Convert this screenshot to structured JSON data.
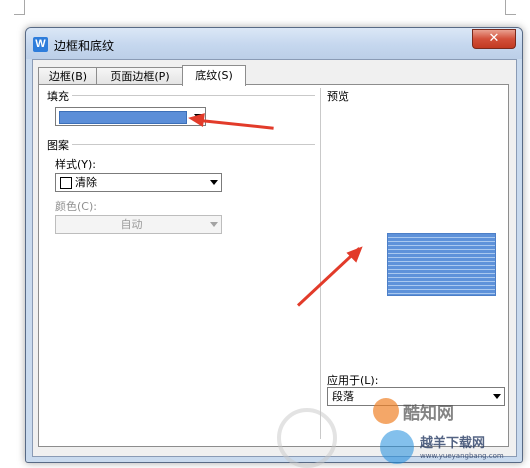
{
  "window": {
    "title": "边框和底纹",
    "app_icon_glyph": "W",
    "close_glyph": "✕"
  },
  "tabs": [
    {
      "label": "边框(B)"
    },
    {
      "label": "页面边框(P)"
    },
    {
      "label": "底纹(S)"
    }
  ],
  "fill": {
    "label": "填充",
    "color": "#5b8ed8"
  },
  "pattern": {
    "label": "图案",
    "style_label": "样式(Y):",
    "style_value": "清除",
    "color_label": "颜色(C):",
    "color_value": "自动"
  },
  "preview": {
    "label": "预览",
    "apply_label": "应用于(L):",
    "apply_value": "段落"
  },
  "annotation_color": "#e23b2a",
  "watermarks": {
    "site_name": "酷知网",
    "site_name_2": "越羊下载网",
    "site_url": "www.yueyangbang.com"
  }
}
